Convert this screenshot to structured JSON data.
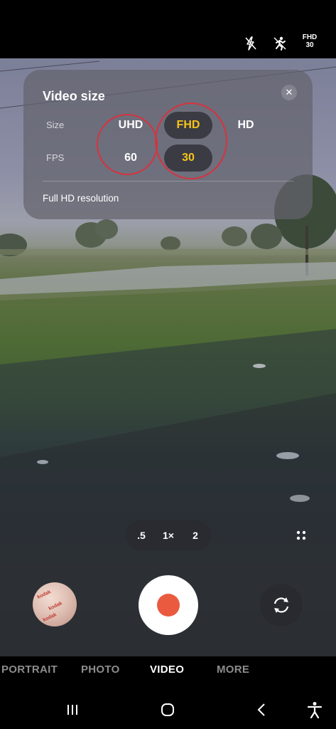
{
  "status_bar": {
    "icons": [
      "flash-off-icon",
      "motion-icon"
    ],
    "video_format": "FHD",
    "video_fps": "30"
  },
  "video_size_panel": {
    "title": "Video size",
    "close_icon": "close-icon",
    "size_label": "Size",
    "fps_label": "FPS",
    "size_options": [
      "UHD",
      "FHD",
      "HD"
    ],
    "selected_size": "FHD",
    "fps_options": [
      "60",
      "30"
    ],
    "selected_fps": "30",
    "description": "Full HD resolution",
    "colors": {
      "selected": "#f5c518",
      "highlight_circle": "#d6333f"
    }
  },
  "zoom": {
    "options": [
      ".5",
      "1×",
      "2"
    ],
    "selected": "1×"
  },
  "controls": {
    "gallery_thumbnail_text": [
      "kodak",
      "kodak",
      "kodak"
    ],
    "shutter_color": "#ea5a3e"
  },
  "modes": {
    "items": [
      "PORTRAIT",
      "PHOTO",
      "VIDEO",
      "MORE"
    ],
    "active": "VIDEO"
  },
  "nav_bar": {
    "icons": [
      "recent-apps-icon",
      "home-icon",
      "back-icon",
      "accessibility-icon"
    ]
  }
}
